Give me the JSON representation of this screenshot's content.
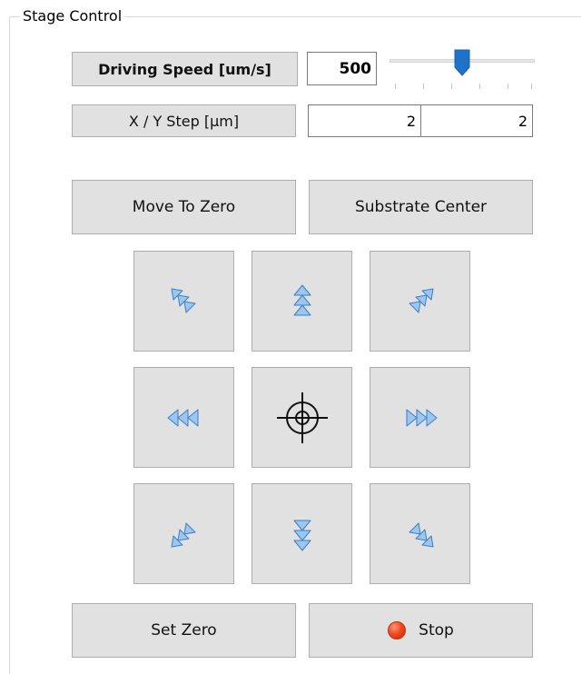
{
  "group": {
    "title": "Stage Control"
  },
  "speed": {
    "label": "Driving Speed [um/s]",
    "value": "500"
  },
  "step": {
    "label": "X / Y Step [µm]",
    "x_value": "2",
    "y_value": "2"
  },
  "buttons": {
    "move_to_zero": "Move To Zero",
    "substrate_center": "Substrate Center",
    "set_zero": "Set Zero",
    "stop": "Stop"
  },
  "colors": {
    "arrow_fill": "#9cc6ee",
    "arrow_stroke": "#3d7fc6",
    "slider_thumb": "#1e73c9",
    "stop_dot": "#f04a20"
  },
  "icons": {
    "up_left": "arrow-up-left-icon",
    "up": "arrow-up-icon",
    "up_right": "arrow-up-right-icon",
    "left": "arrow-left-icon",
    "center": "crosshair-icon",
    "right": "arrow-right-icon",
    "down_left": "arrow-down-left-icon",
    "down": "arrow-down-icon",
    "down_right": "arrow-down-right-icon"
  }
}
